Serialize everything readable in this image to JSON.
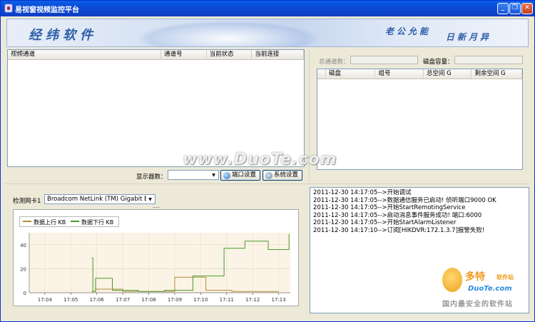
{
  "window": {
    "title": "易视窗视频监控平台",
    "minimize_label": "_",
    "restore_label": "❐",
    "close_label": "✕"
  },
  "banner": {
    "logo_text": "经纬软件",
    "slogan_left": "老公允能",
    "slogan_right": "日新月异"
  },
  "channel_list": {
    "columns": [
      "视频通道",
      "通道号",
      "当前状态",
      "当前连接"
    ],
    "rows": []
  },
  "storage": {
    "total_channels_label": "总通道数：",
    "total_channels_value": "",
    "disk_capacity_label": "磁盘容量：",
    "disk_capacity_value": "",
    "columns": [
      "磁盘",
      "组号",
      "总空间 G",
      "剩余空间 G"
    ],
    "rows": []
  },
  "display_controls": {
    "monitor_label": "显示器数：",
    "monitor_value": "",
    "port_button": "端口设置",
    "system_button": "系统设置"
  },
  "network": {
    "nic_label": "检测网卡1",
    "nic_value": "Broadcom NetLink (TM) Gigabit Eth"
  },
  "chart_data": {
    "type": "line",
    "title": "",
    "xlabel": "",
    "ylabel": "",
    "x": [
      "17:04",
      "17:05",
      "17:06",
      "17:07",
      "17:08",
      "17:09",
      "17:10",
      "17:11",
      "17:12",
      "17:13"
    ],
    "ylim": [
      0,
      50
    ],
    "yticks": [
      0,
      20,
      40
    ],
    "grid": true,
    "legend_position": "top-left",
    "series": [
      {
        "name": "数据上行 KB",
        "color": "#b08a3a",
        "points": [
          [
            5.8,
            1
          ],
          [
            5.95,
            1
          ],
          [
            5.95,
            3
          ],
          [
            7.0,
            3
          ],
          [
            7.0,
            1
          ],
          [
            8.0,
            1
          ],
          [
            8.0,
            1
          ],
          [
            9.0,
            1
          ],
          [
            9.0,
            13
          ],
          [
            10.2,
            13
          ],
          [
            10.2,
            2
          ],
          [
            11.2,
            2
          ],
          [
            11.2,
            1
          ],
          [
            12.2,
            1
          ],
          [
            12.2,
            1
          ],
          [
            13.0,
            1
          ]
        ]
      },
      {
        "name": "数据下行 KB",
        "color": "#4a9a2a",
        "points": [
          [
            5.8,
            29
          ],
          [
            5.85,
            29
          ],
          [
            5.85,
            1
          ],
          [
            5.95,
            1
          ],
          [
            5.95,
            12
          ],
          [
            6.6,
            12
          ],
          [
            6.6,
            2
          ],
          [
            7.6,
            2
          ],
          [
            7.6,
            1
          ],
          [
            8.6,
            1
          ],
          [
            8.6,
            2
          ],
          [
            9.7,
            2
          ],
          [
            9.7,
            14
          ],
          [
            10.9,
            14
          ],
          [
            10.9,
            37
          ],
          [
            11.7,
            37
          ],
          [
            11.7,
            43
          ],
          [
            12.6,
            43
          ],
          [
            12.6,
            36
          ],
          [
            13.4,
            36
          ],
          [
            13.4,
            49
          ]
        ]
      }
    ]
  },
  "log": {
    "lines": [
      "2011-12-30 14:17:05-->开始调试",
      "2011-12-30 14:17:05-->数据通信服务已启动! 侦听端口9000 OK",
      "2011-12-30 14:17:05-->开始StartRemotingService",
      "2011-12-30 14:17:05-->启动消息事件服务成功! 端口:6000",
      "2011-12-30 14:17:05-->开始StartAlarmListener",
      "2011-12-30 14:17:10-->订阅[HIKDVR:172.1.3.7]报警失败!"
    ]
  },
  "watermarks": {
    "center": "www.DuoTe.com",
    "brand": "多特",
    "brand_sub": "软件站",
    "brand_domain": "DuoTe.com",
    "brand_slogan": "国内最安全的软件站"
  }
}
